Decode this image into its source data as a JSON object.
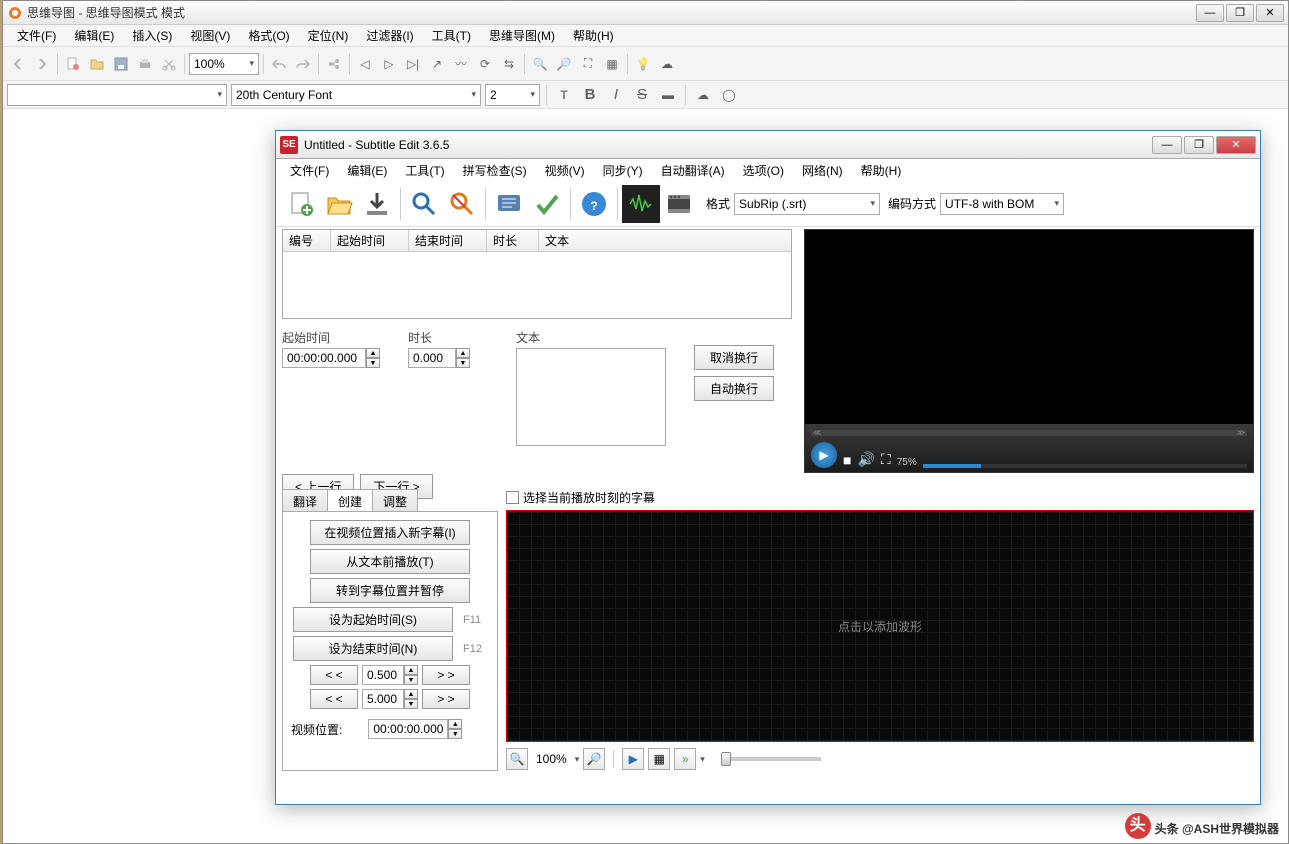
{
  "outer": {
    "title": "思维导图 - 思维导图模式 模式",
    "menu": [
      "文件(F)",
      "编辑(E)",
      "插入(S)",
      "视图(V)",
      "格式(O)",
      "定位(N)",
      "过滤器(I)",
      "工具(T)",
      "思维导图(M)",
      "帮助(H)"
    ],
    "zoom": "100%",
    "font_name": "20th Century Font",
    "font_size": "2"
  },
  "sub": {
    "title": "Untitled - Subtitle Edit 3.6.5",
    "menu": [
      "文件(F)",
      "编辑(E)",
      "工具(T)",
      "拼写检查(S)",
      "视频(V)",
      "同步(Y)",
      "自动翻译(A)",
      "选项(O)",
      "网络(N)",
      "帮助(H)"
    ],
    "format_label": "格式",
    "format_value": "SubRip (.srt)",
    "encoding_label": "编码方式",
    "encoding_value": "UTF-8 with BOM",
    "list_headers": {
      "num": "编号",
      "start": "起始时间",
      "end": "结束时间",
      "dur": "时长",
      "text": "文本"
    },
    "edit": {
      "start_label": "起始时间",
      "start_value": "00:00:00.000",
      "dur_label": "时长",
      "dur_value": "0.000",
      "text_label": "文本",
      "unwrap": "取消换行",
      "autowrap": "自动换行",
      "prev": "< 上一行",
      "next": "下一行 >"
    },
    "video": {
      "percent": "75%"
    },
    "tabs": {
      "translate": "翻译",
      "create": "创建",
      "adjust": "调整"
    },
    "create": {
      "insert_at_video": "在视频位置插入新字幕(I)",
      "play_from_text": "从文本前播放(T)",
      "goto_and_pause": "转到字幕位置并暂停",
      "set_start": "设为起始时间(S)",
      "set_start_key": "F11",
      "set_end": "设为结束时间(N)",
      "set_end_key": "F12",
      "back_small_val": "0.500",
      "fwd_big_val": "5.000",
      "back": "< <",
      "fwd": "> >",
      "video_pos_label": "视频位置:",
      "video_pos_value": "00:00:00.000"
    },
    "wave": {
      "checkbox_label": "选择当前播放时刻的字幕",
      "placeholder": "点击以添加波形",
      "zoom": "100%"
    }
  },
  "watermark": "头条 @ASH世界模拟器"
}
